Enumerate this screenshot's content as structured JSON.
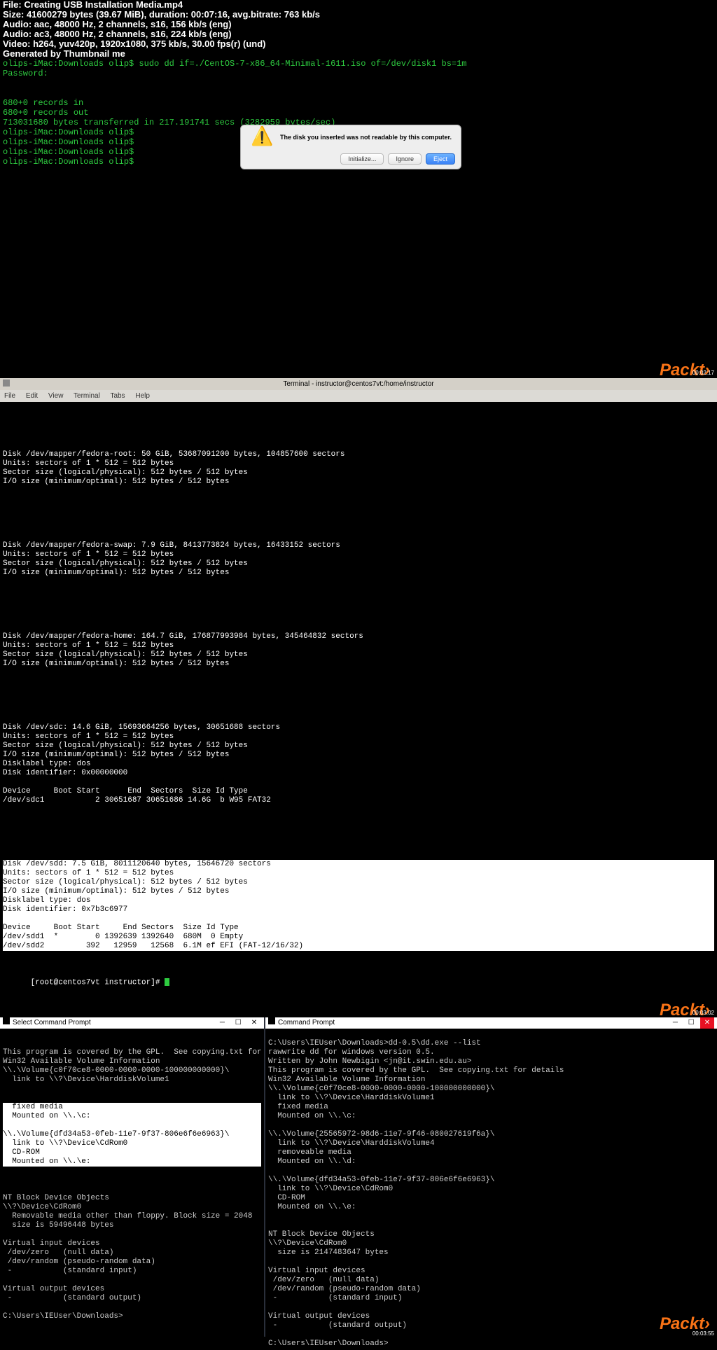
{
  "panel1": {
    "file_label": "File: Creating USB Installation Media.mp4",
    "size_line": "Size: 41600279 bytes (39.67 MiB), duration: 00:07:16, avg.bitrate: 763 kb/s",
    "audio1": "Audio: aac, 48000 Hz, 2 channels, s16, 156 kb/s (eng)",
    "audio2": "Audio: ac3, 48000 Hz, 2 channels, s16, 224 kb/s (eng)",
    "video": "Video: h264, yuv420p, 1920x1080, 375 kb/s, 30.00 fps(r) (und)",
    "generated": "Generated by Thumbnail me",
    "cmd": "olips-iMac:Downloads olip$ sudo dd if=./CentOS-7-x86_64-Minimal-1611.iso of=/dev/disk1 bs=1m",
    "password": "Password:",
    "rec_in": "680+0 records in",
    "rec_out": "680+0 records out",
    "transfer": "713031680 bytes transferred in 217.191741 secs (3282959 bytes/sec)",
    "prompt": "olips-iMac:Downloads olip$",
    "dialog_msg": "The disk you inserted was not readable by this computer.",
    "btn_init": "Initialize...",
    "btn_ignore": "Ignore",
    "btn_eject": "Eject",
    "brand": "Packt›",
    "time": "00:02:17"
  },
  "panel2": {
    "title": "Terminal - instructor@centos7vt:/home/instructor",
    "menu": {
      "file": "File",
      "edit": "Edit",
      "view": "View",
      "terminal": "Terminal",
      "tabs": "Tabs",
      "help": "Help"
    },
    "blocks": {
      "fedora_root": "Disk /dev/mapper/fedora-root: 50 GiB, 53687091200 bytes, 104857600 sectors\nUnits: sectors of 1 * 512 = 512 bytes\nSector size (logical/physical): 512 bytes / 512 bytes\nI/O size (minimum/optimal): 512 bytes / 512 bytes",
      "fedora_swap": "Disk /dev/mapper/fedora-swap: 7.9 GiB, 8413773824 bytes, 16433152 sectors\nUnits: sectors of 1 * 512 = 512 bytes\nSector size (logical/physical): 512 bytes / 512 bytes\nI/O size (minimum/optimal): 512 bytes / 512 bytes",
      "fedora_home": "Disk /dev/mapper/fedora-home: 164.7 GiB, 176877993984 bytes, 345464832 sectors\nUnits: sectors of 1 * 512 = 512 bytes\nSector size (logical/physical): 512 bytes / 512 bytes\nI/O size (minimum/optimal): 512 bytes / 512 bytes",
      "sdc": "Disk /dev/sdc: 14.6 GiB, 15693664256 bytes, 30651688 sectors\nUnits: sectors of 1 * 512 = 512 bytes\nSector size (logical/physical): 512 bytes / 512 bytes\nI/O size (minimum/optimal): 512 bytes / 512 bytes\nDisklabel type: dos\nDisk identifier: 0x00000000\n\nDevice     Boot Start      End  Sectors  Size Id Type\n/dev/sdc1           2 30651687 30651686 14.6G  b W95 FAT32",
      "sdd": "Disk /dev/sdd: 7.5 GiB, 8011120640 bytes, 15646720 sectors\nUnits: sectors of 1 * 512 = 512 bytes\nSector size (logical/physical): 512 bytes / 512 bytes\nI/O size (minimum/optimal): 512 bytes / 512 bytes\nDisklabel type: dos\nDisk identifier: 0x7b3c6977\n\nDevice     Boot Start     End Sectors  Size Id Type\n/dev/sdd1  *        0 1392639 1392640  680M  0 Empty\n/dev/sdd2         392   12959   12568  6.1M ef EFI (FAT-12/16/32)"
    },
    "prompt": "[root@centos7vt instructor]# ",
    "brand": "Packt›",
    "time": "00:03:02"
  },
  "panel3": {
    "left_title": "Select Command Prompt",
    "right_title": "Command Prompt",
    "left_body": "This program is covered by the GPL.  See copying.txt for details\nWin32 Available Volume Information\n\\\\.\\Volume{c0f70ce8-0000-0000-0000-100000000000}\\\n  link to \\\\?\\Device\\HarddiskVolume1",
    "left_highlight": "  fixed media\n  Mounted on \\\\.\\c:\n\n\\\\.\\Volume{dfd34a53-0feb-11e7-9f37-806e6f6e6963}\\\n  link to \\\\?\\Device\\CdRom0\n  CD-ROM\n  Mounted on \\\\.\\e:",
    "left_body2": "\nNT Block Device Objects\n\\\\?\\Device\\CdRom0\n  Removable media other than floppy. Block size = 2048\n  size is 59496448 bytes\n\nVirtual input devices\n /dev/zero   (null data)\n /dev/random (pseudo-random data)\n -           (standard input)\n\nVirtual output devices\n -           (standard output)\n\nC:\\Users\\IEUser\\Downloads>",
    "right_body": "\nC:\\Users\\IEUser\\Downloads>dd-0.5\\dd.exe --list\nrawwrite dd for windows version 0.5.\nWritten by John Newbigin <jn@it.swin.edu.au>\nThis program is covered by the GPL.  See copying.txt for details\nWin32 Available Volume Information\n\\\\.\\Volume{c0f70ce8-0000-0000-0000-100000000000}\\\n  link to \\\\?\\Device\\HarddiskVolume1\n  fixed media\n  Mounted on \\\\.\\c:\n\n\\\\.\\Volume{25565972-98d6-11e7-9f46-080027619f6a}\\\n  link to \\\\?\\Device\\HarddiskVolume4\n  removeable media\n  Mounted on \\\\.\\d:\n\n\\\\.\\Volume{dfd34a53-0feb-11e7-9f37-806e6f6e6963}\\\n  link to \\\\?\\Device\\CdRom0\n  CD-ROM\n  Mounted on \\\\.\\e:\n\n\nNT Block Device Objects\n\\\\?\\Device\\CdRom0\n  size is 2147483647 bytes\n\nVirtual input devices\n /dev/zero   (null data)\n /dev/random (pseudo-random data)\n -           (standard input)\n\nVirtual output devices\n -           (standard output)\n\nC:\\Users\\IEUser\\Downloads>",
    "brand": "Packt›",
    "time": "00:03:55"
  }
}
